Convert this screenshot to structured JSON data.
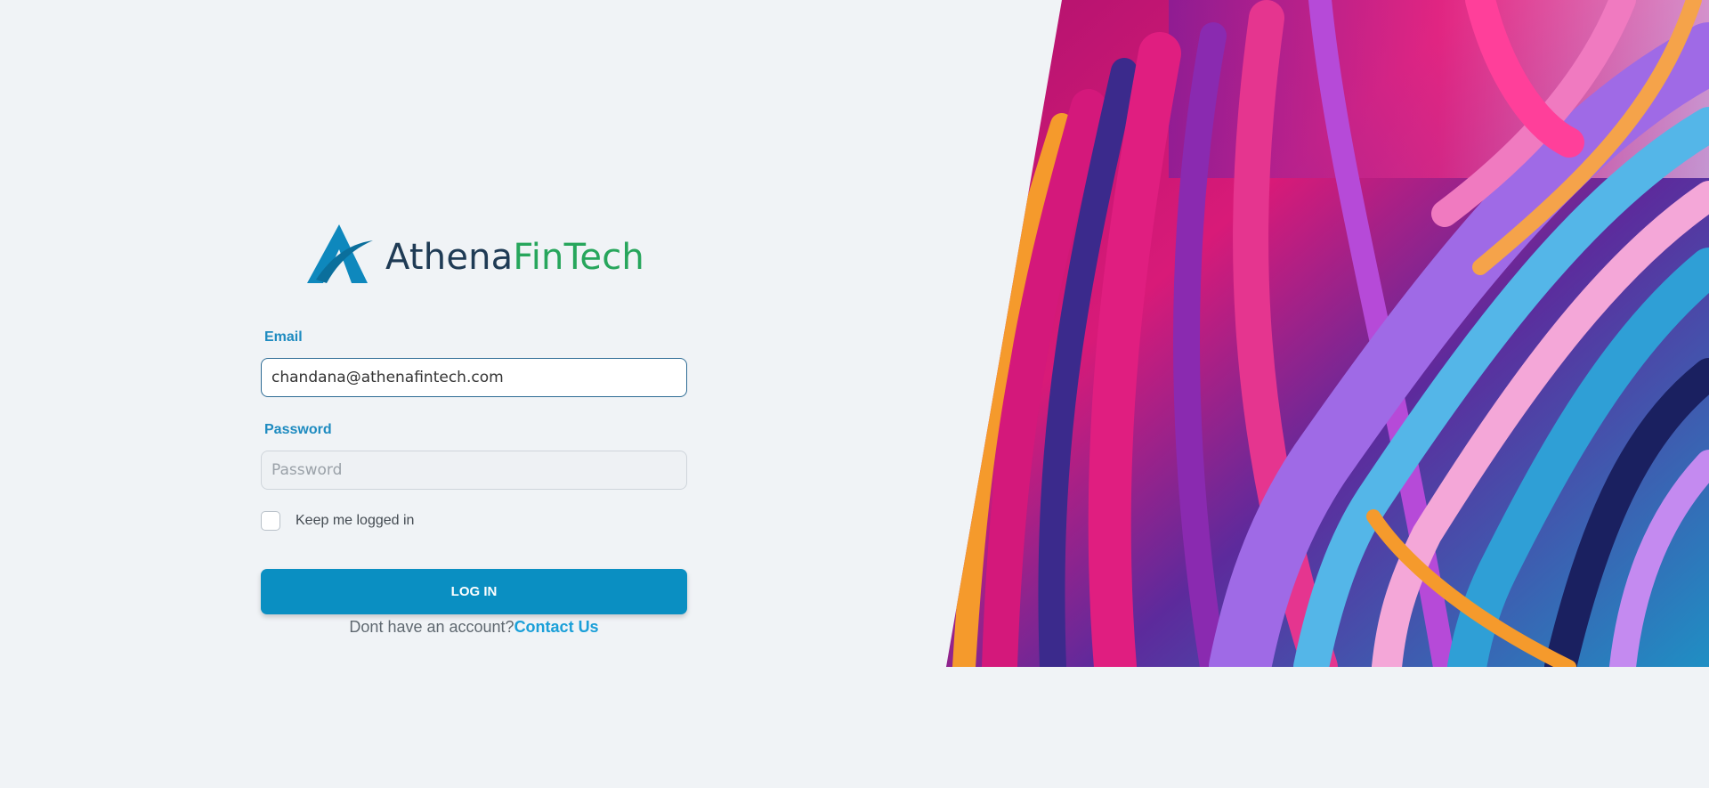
{
  "brand": {
    "name_part1": "Athena",
    "name_part2": "FinTech",
    "mark_color": "#0e88bd",
    "name_color": "#1f3b55",
    "accent_color": "#27a65c"
  },
  "form": {
    "email_label": "Email",
    "email_value": "chandana@athenafintech.com",
    "password_label": "Password",
    "password_placeholder": "Password",
    "remember_label": "Keep me logged in",
    "remember_checked": false,
    "login_label": "LOG IN",
    "signup_prompt": "Dont have an account?",
    "signup_link": "Contact Us"
  },
  "colors": {
    "background": "#f0f3f6",
    "label": "#1e8bc0",
    "button": "#0a8fc2",
    "link": "#1a9fd8"
  },
  "art": {
    "description_icon": "abstract-swirl-image"
  }
}
